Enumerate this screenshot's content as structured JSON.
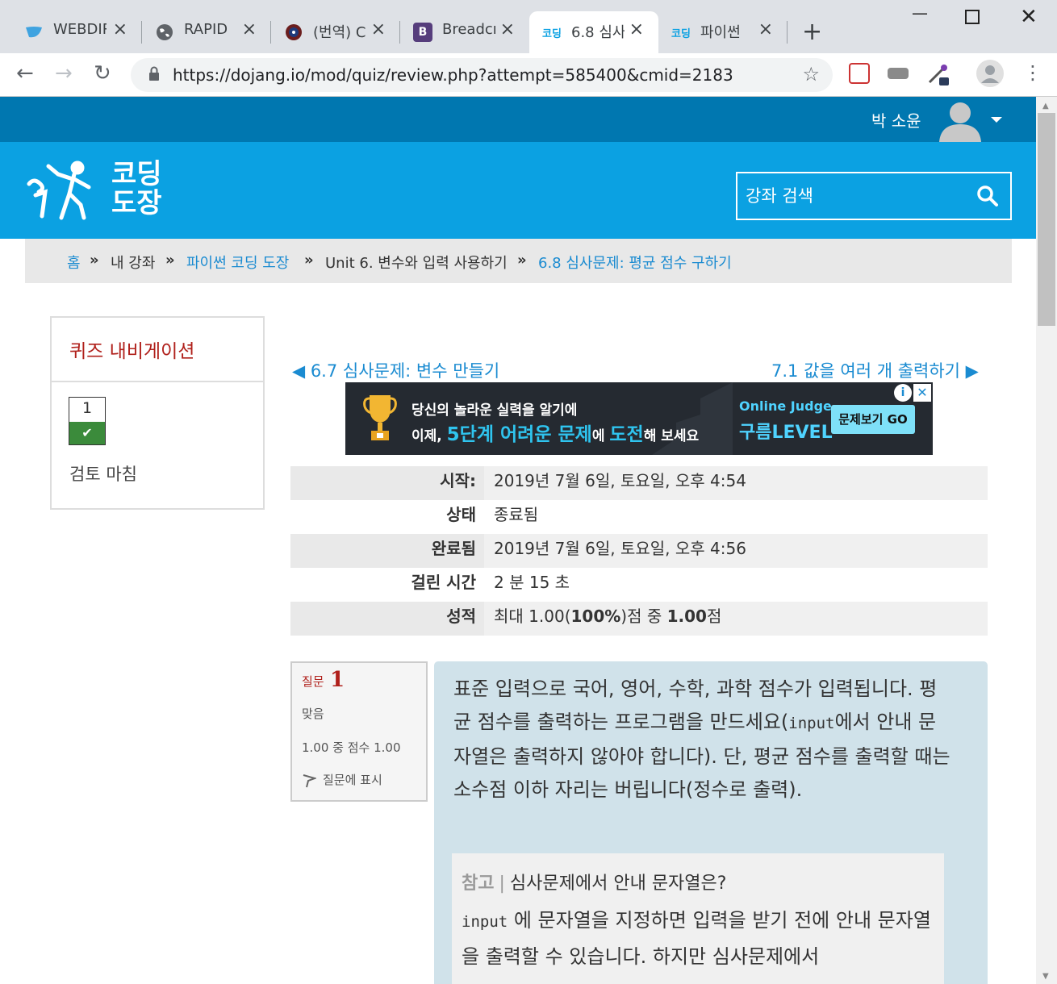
{
  "browser": {
    "tabs": [
      {
        "title": "WEBDIR"
      },
      {
        "title": "RAPID"
      },
      {
        "title": "(번역) C"
      },
      {
        "title": "Breadcr"
      },
      {
        "title": "6.8 심사"
      },
      {
        "title": "파이썬"
      }
    ],
    "url": "https://dojang.io/mod/quiz/review.php?attempt=585400&cmid=2183"
  },
  "user": {
    "name": "박 소윤"
  },
  "logo": {
    "line1": "코딩",
    "line2": "도장"
  },
  "search": {
    "placeholder": "강좌 검색"
  },
  "breadcrumb": {
    "home": "홈",
    "my_courses": "내 강좌",
    "course": "파이썬 코딩 도장",
    "unit": "Unit 6. 변수와 입력 사용하기",
    "current": "6.8 심사문제: 평균 점수 구하기",
    "sep": "»"
  },
  "quiz_nav": {
    "title": "퀴즈 내비게이션",
    "question_number": "1",
    "finish_review": "검토 마침"
  },
  "pager": {
    "prev": "◀ 6.7 심사문제: 변수 만들기",
    "next": "7.1 값을 여러 개 출력하기 ▶"
  },
  "ad": {
    "line1": "당신의 놀라운 실력을 알기에",
    "line2_a": "이제, ",
    "line2_b": "5단계 어려운 문제",
    "line2_c": "에 ",
    "line2_d": "도전",
    "line2_e": "해 보세요",
    "brand_top": "Online Judge",
    "brand_bottom": "구름LEVEL",
    "cta": "문제보기 GO"
  },
  "summary": {
    "rows": [
      {
        "label": "시작:",
        "value": "2019년 7월 6일, 토요일, 오후 4:54"
      },
      {
        "label": "상태",
        "value": "종료됨"
      },
      {
        "label": "완료됨",
        "value": "2019년 7월 6일, 토요일, 오후 4:56"
      },
      {
        "label": "걸린 시간",
        "value": "2 분 15 초"
      },
      {
        "label": "성적",
        "value_a": "최대 1.00(",
        "value_b": "100%",
        "value_c": ")점 중 ",
        "value_d": "1.00",
        "value_e": "점"
      }
    ]
  },
  "question": {
    "label": "질문",
    "number": "1",
    "state": "맞음",
    "grade": "1.00 중 점수 1.00",
    "flag": "질문에 표시",
    "text_a": "표준 입력으로 국어, 영어, 수학, 과학 점수가 입력됩니다. 평균 점수를 출력하는 프로그램을 만드세요(",
    "text_code": "input",
    "text_b": "에서 안내 문자열은 출력하지 않아야 합니다). 단, 평균 점수를 출력할 때는 소수점 이하 자리는 버립니다(정수로 출력).",
    "note_tag": "참고",
    "note_sep": "|",
    "note_title": "심사문제에서 안내 문자열은?",
    "note_code": "input",
    "note_body": "에 문자열을 지정하면 입력을 받기 전에 안내 문자열을 출력할 수 있습니다. 하지만 심사문제에서"
  },
  "colors": {
    "topbar": "#0077b0",
    "header": "#0ba1e2",
    "link": "#1a8bd1",
    "accent_red": "#b0201b",
    "correct_green": "#3b8b3b",
    "question_bg": "#d0e2ea"
  }
}
